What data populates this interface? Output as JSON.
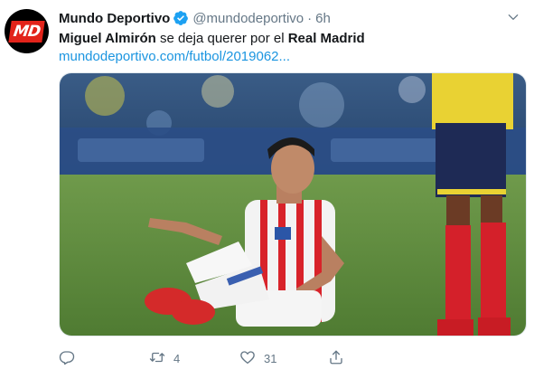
{
  "author": {
    "name": "Mundo Deportivo",
    "handle": "@mundodeportivo",
    "separator": "·",
    "time": "6h",
    "avatar_text": "MD"
  },
  "tweet": {
    "text_parts": [
      "Miguel Almirón",
      " se deja querer por el ",
      "Real Madrid"
    ],
    "link": "mundodeportivo.com/futbol/2019062..."
  },
  "actions": {
    "reply_count": "",
    "retweet_count": "4",
    "like_count": "31"
  },
  "colors": {
    "link": "#1b95e0",
    "muted": "#657786",
    "verified": "#1da1f2"
  },
  "icons": {
    "verified": "verified-badge-icon",
    "caret": "chevron-down-icon",
    "reply": "reply-icon",
    "retweet": "retweet-icon",
    "like": "heart-icon",
    "share": "share-icon"
  }
}
